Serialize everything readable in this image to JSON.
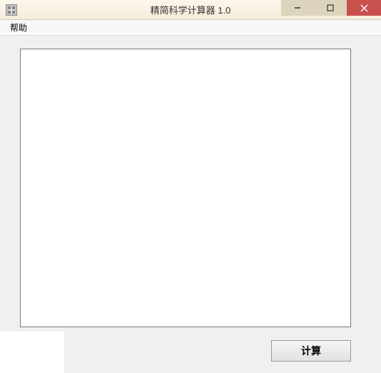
{
  "window": {
    "title": "精简科学计算器 1.0"
  },
  "menubar": {
    "help": "帮助"
  },
  "editor": {
    "value": ""
  },
  "actions": {
    "calculate": "计算"
  },
  "icons": {
    "app": "app-icon",
    "minimize": "minimize-icon",
    "maximize": "maximize-icon",
    "close": "close-icon"
  }
}
